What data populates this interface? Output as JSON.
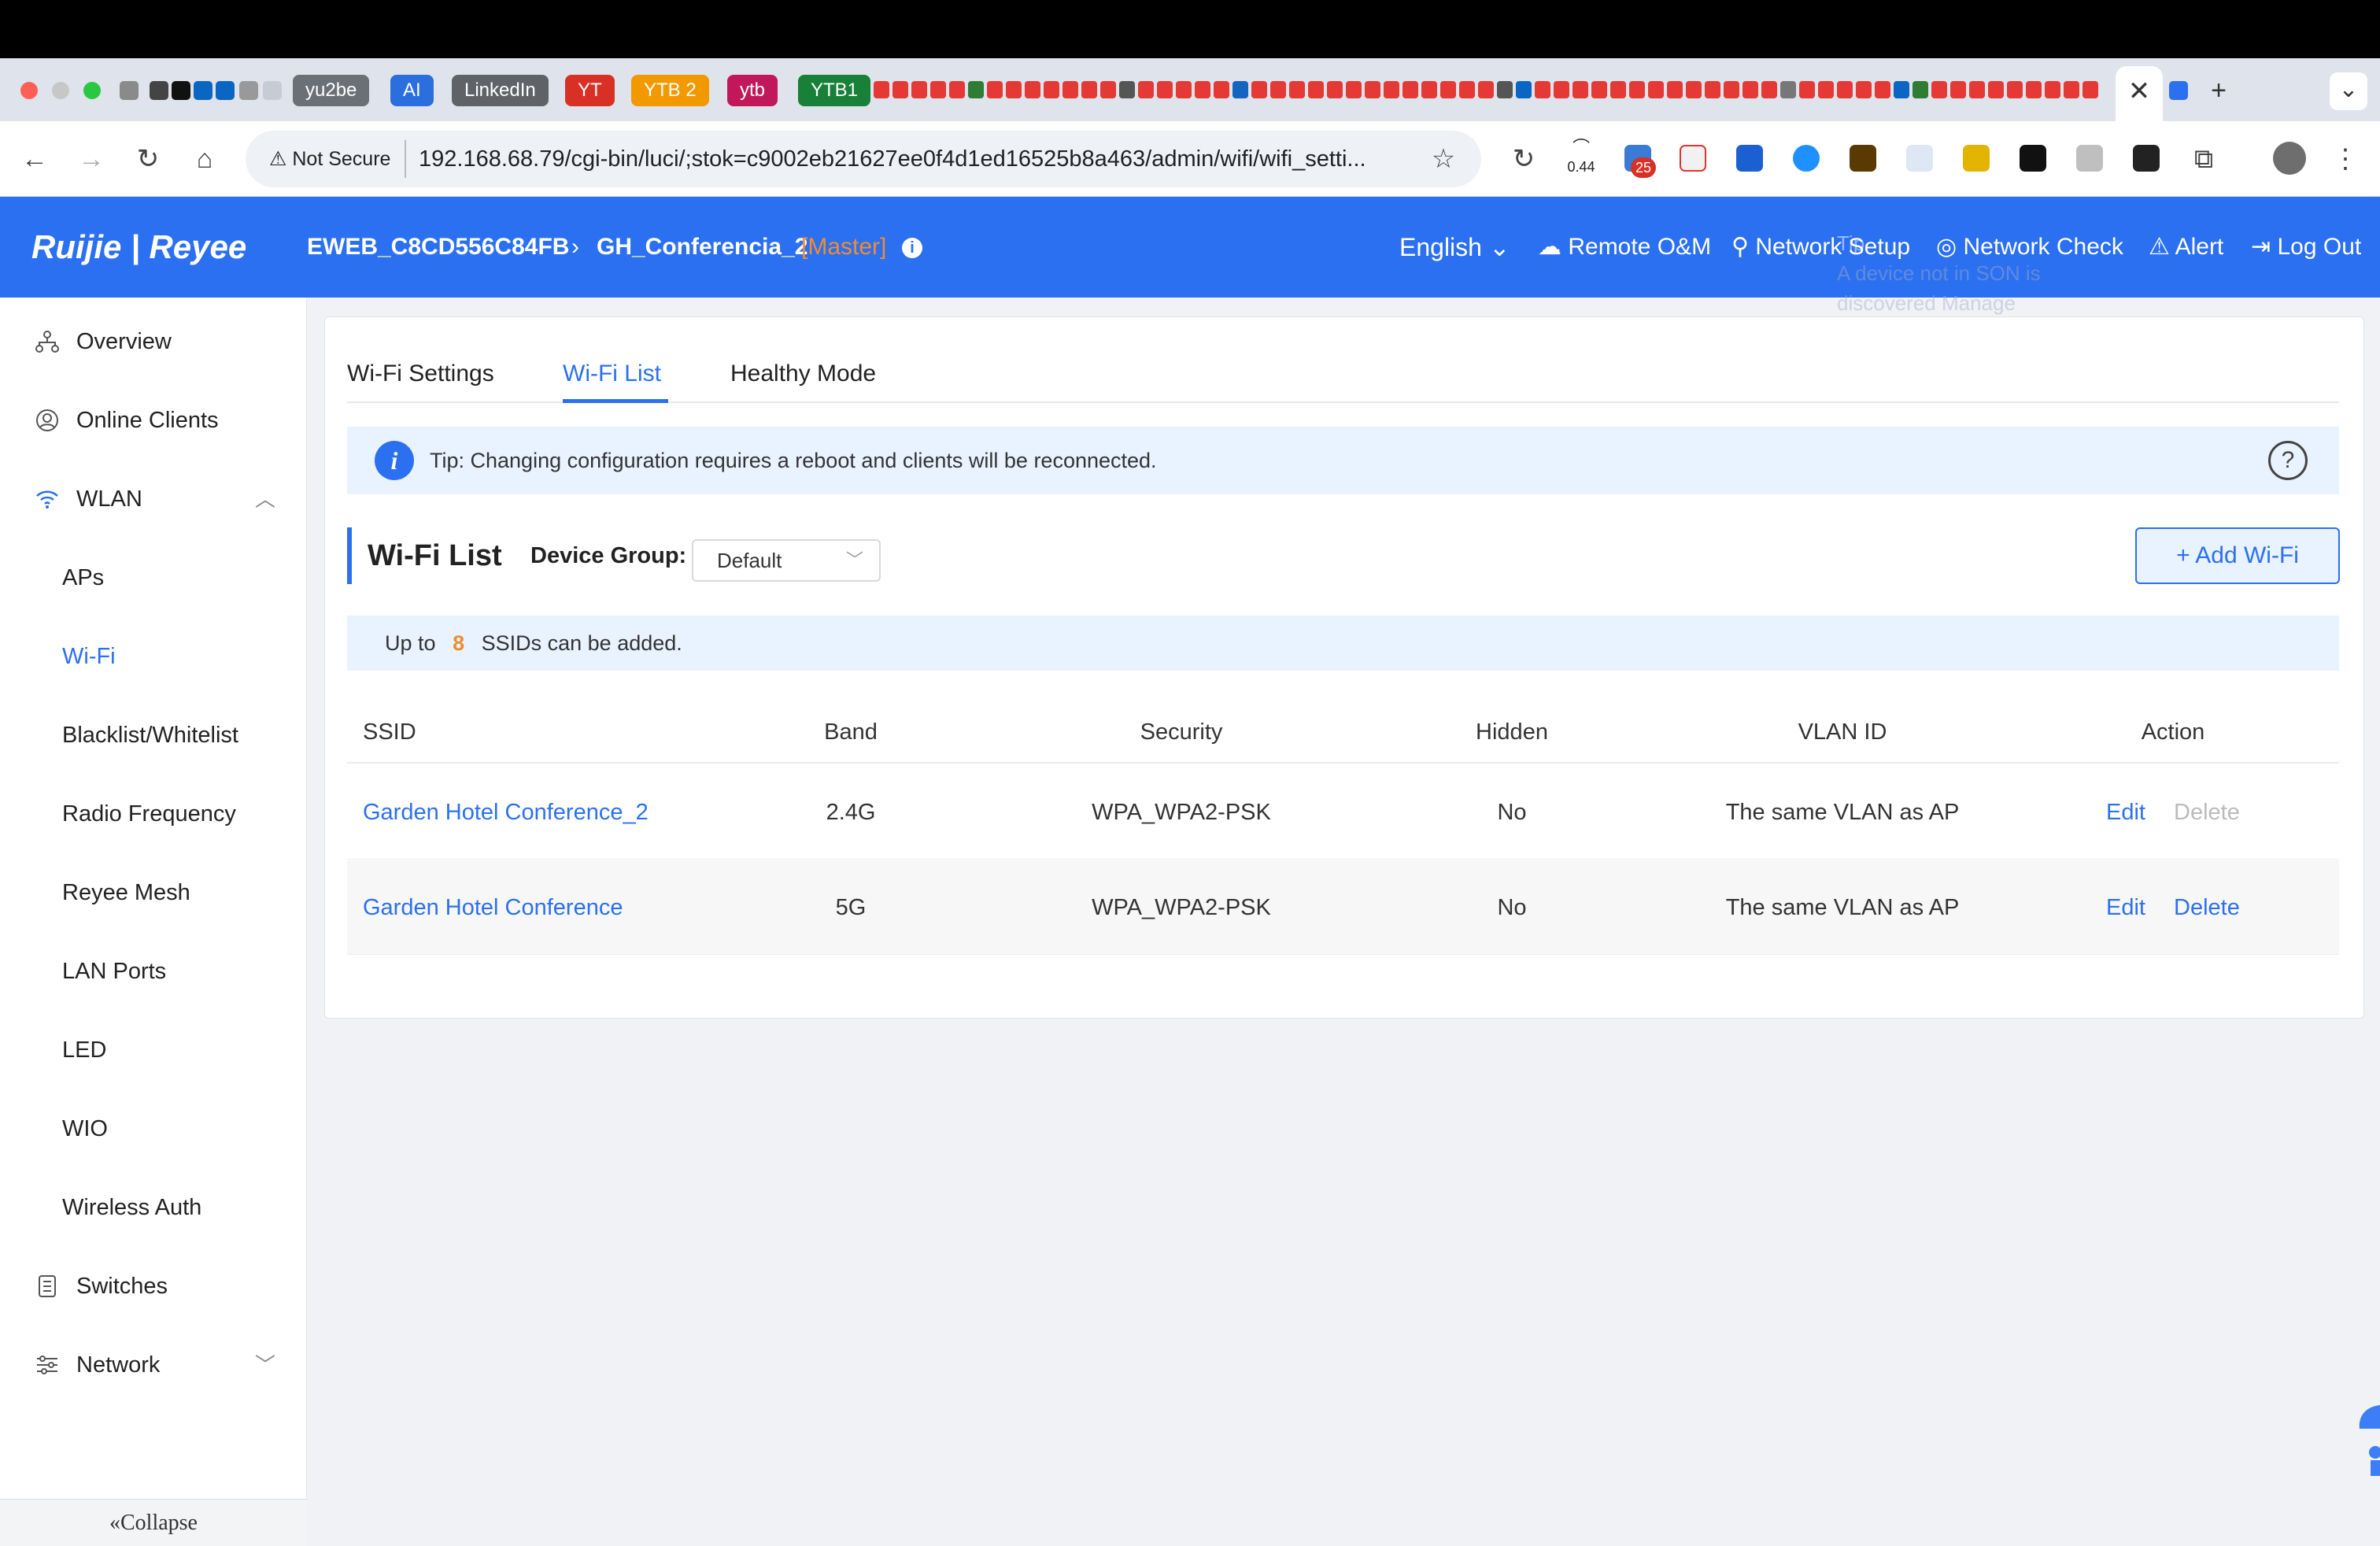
{
  "browser": {
    "tab_chips": [
      {
        "label": "yu2be",
        "color": "#6b6f76"
      },
      {
        "label": "AI",
        "color": "#2b6fde"
      },
      {
        "label": "LinkedIn",
        "color": "#5f6368"
      },
      {
        "label": "YT",
        "color": "#d93025"
      },
      {
        "label": "YTB 2",
        "color": "#f29900"
      },
      {
        "label": "ytb",
        "color": "#c2185b"
      },
      {
        "label": "YTB1",
        "color": "#188038"
      }
    ],
    "new_tab": "+",
    "close_tab": "✕",
    "tab_menu": "⌄",
    "security_label": "Not Secure",
    "url": "192.168.68.79/cgi-bin/luci/;stok=c9002eb21627ee0f4d1ed16525b8a463/admin/wifi/wifi_setti...",
    "ext_badge_num": "25",
    "ext_speed": "0.44"
  },
  "header": {
    "logo": "Ruijie | Reyee",
    "device": "EWEB_C8CD556C84FB",
    "ap_name": "GH_Conferencia_2",
    "ap_role": "[Master]",
    "language": "English",
    "menu": [
      "Remote O&M",
      "Network Setup",
      "Network Check",
      "Alert",
      "Log Out"
    ],
    "tooltip_lines": [
      "Tip",
      "A device not in SON is",
      "discovered Manage"
    ]
  },
  "sidebar": {
    "items": [
      {
        "label": "Overview"
      },
      {
        "label": "Online Clients"
      },
      {
        "label": "WLAN"
      }
    ],
    "wlan_sub": [
      "APs",
      "Wi-Fi",
      "Blacklist/Whitelist",
      "Radio Frequency",
      "Reyee Mesh",
      "LAN Ports",
      "LED",
      "WIO",
      "Wireless Auth"
    ],
    "bottom_items": [
      {
        "label": "Switches"
      },
      {
        "label": "Network"
      }
    ],
    "collapse": "«Collapse"
  },
  "main": {
    "tabs": [
      "Wi-Fi Settings",
      "Wi-Fi List",
      "Healthy Mode"
    ],
    "active_tab": 1,
    "tip": "Tip: Changing configuration requires a reboot and clients will be reconnected.",
    "list_title": "Wi-Fi List",
    "device_group_label": "Device Group:",
    "device_group_value": "Default",
    "add_button": "+ Add Wi-Fi",
    "upto_prefix": "Up to",
    "upto_count": "8",
    "upto_suffix": "SSIDs can be added.",
    "table": {
      "columns": [
        "SSID",
        "Band",
        "Security",
        "Hidden",
        "VLAN ID",
        "Action"
      ],
      "rows": [
        {
          "ssid": "Garden Hotel Conference_2",
          "band": "2.4G",
          "security": "WPA_WPA2-PSK",
          "hidden": "No",
          "vlan": "The same VLAN as AP",
          "edit": "Edit",
          "delete": "Delete",
          "delete_enabled": false
        },
        {
          "ssid": "Garden Hotel Conference",
          "band": "5G",
          "security": "WPA_WPA2-PSK",
          "hidden": "No",
          "vlan": "The same VLAN as AP",
          "edit": "Edit",
          "delete": "Delete",
          "delete_enabled": true
        }
      ]
    }
  },
  "colors": {
    "accent": "#2b70f0",
    "master": "#f08c32",
    "count": "#f08c32"
  }
}
